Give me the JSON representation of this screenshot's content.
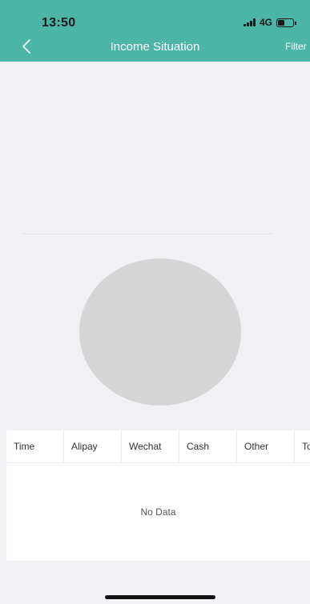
{
  "status_bar": {
    "time": "13:50",
    "network": "4G",
    "battery_level": 0.45
  },
  "nav": {
    "title": "Income Situation",
    "back_icon": "chevron-left-icon",
    "filter_label": "Filter"
  },
  "table": {
    "columns": [
      "Time",
      "Alipay",
      "Wechat",
      "Cash",
      "Other",
      "To"
    ],
    "empty_text": "No Data"
  },
  "colors": {
    "header_bg": "#4cb5a8",
    "page_bg": "#f1f0f5",
    "pie_empty": "#d6d6d6"
  }
}
